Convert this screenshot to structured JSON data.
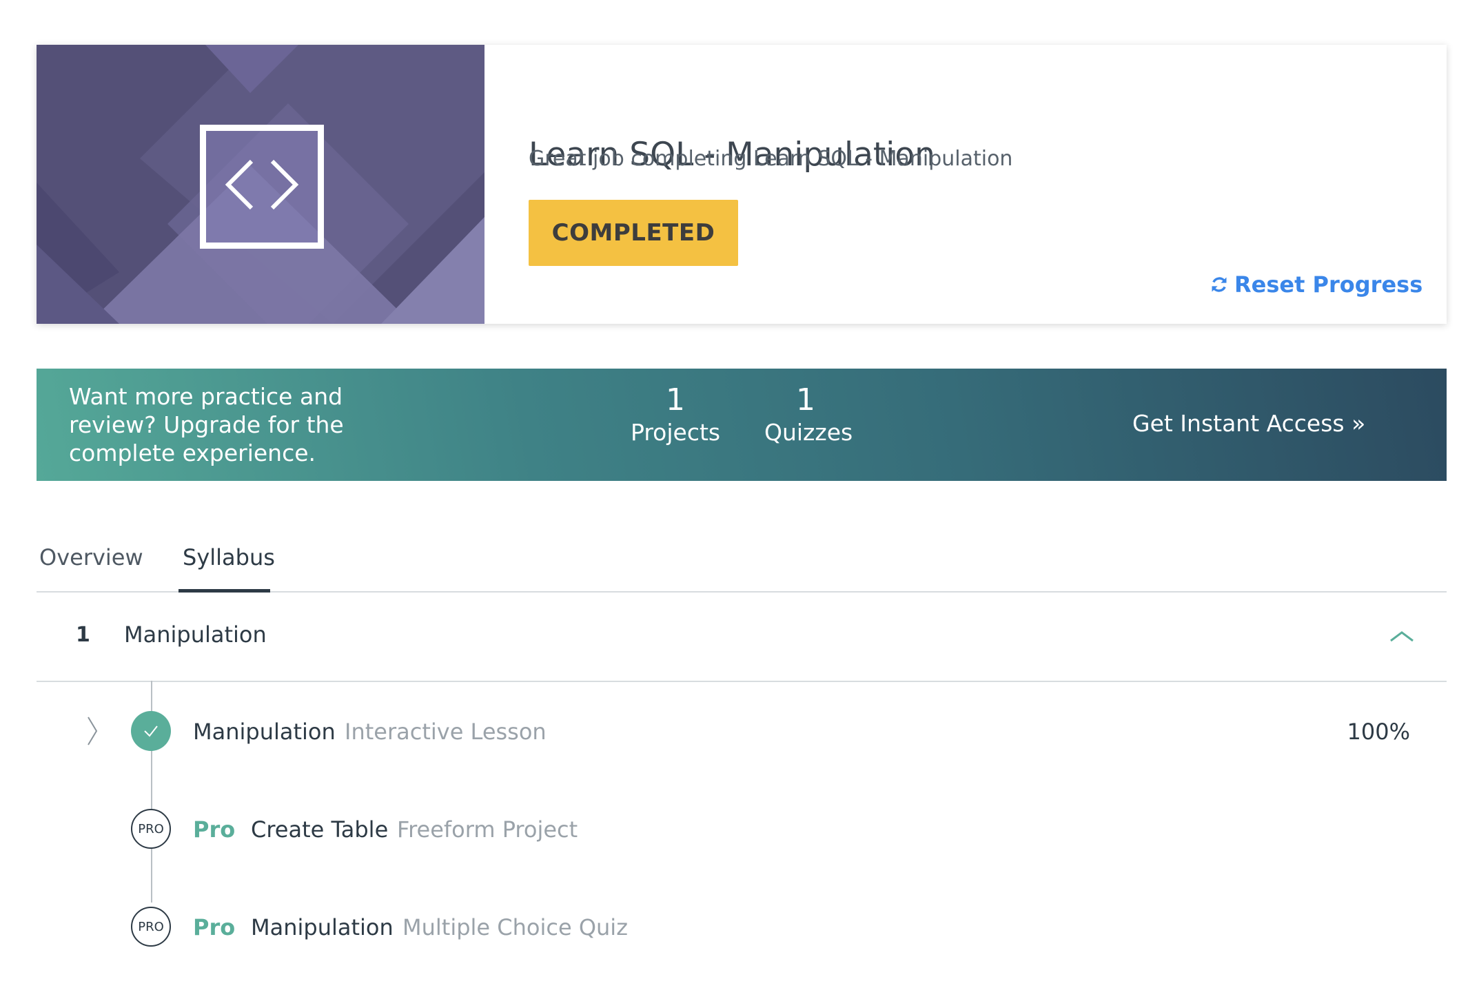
{
  "course": {
    "title": "Learn SQL - Manipulation",
    "subtitle": "Great job completing Learn SQL - Manipulation",
    "status_badge": "COMPLETED",
    "reset_label": "Reset Progress",
    "art_icon": "code-brackets-icon",
    "refresh_icon": "refresh-icon"
  },
  "upgrade_banner": {
    "pitch": "Want more practice and review? Upgrade for the complete experience.",
    "stats": [
      {
        "value": "1",
        "label": "Projects"
      },
      {
        "value": "1",
        "label": "Quizzes"
      }
    ],
    "cta": "Get Instant Access »"
  },
  "tabs": [
    {
      "label": "Overview",
      "active": false
    },
    {
      "label": "Syllabus",
      "active": true
    }
  ],
  "module": {
    "number": "1",
    "name": "Manipulation",
    "expanded": true,
    "collapse_icon": "chevron-up-icon"
  },
  "syllabus_items": [
    {
      "name": "Manipulation",
      "type": "Interactive Lesson",
      "progress": "100%",
      "status": "completed",
      "icon": "check-icon"
    },
    {
      "pro_label": "Pro",
      "name": "Create Table",
      "type": "Freeform Project",
      "badge": "PRO",
      "icon": "pro-badge-icon"
    },
    {
      "pro_label": "Pro",
      "name": "Manipulation",
      "type": "Multiple Choice Quiz",
      "badge": "PRO",
      "icon": "pro-badge-icon"
    }
  ],
  "colors": {
    "completed_badge": "#f4c142",
    "link": "#3a86e9",
    "accent_green": "#5aae9a",
    "banner_start": "#55a898",
    "banner_end": "#2c4b60",
    "art_purple": "#545077"
  }
}
